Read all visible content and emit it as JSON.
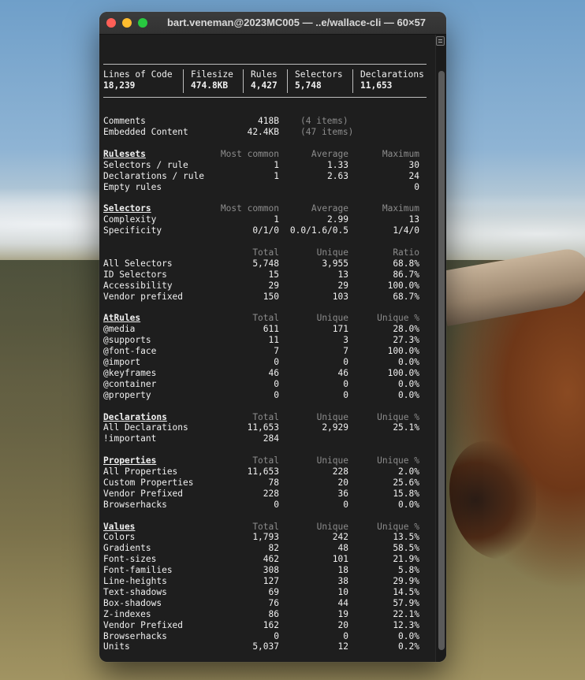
{
  "window": {
    "title": "bart.veneman@2023MC005 — ..e/wallace-cli — 60×57"
  },
  "summary": [
    {
      "label": "Lines of Code",
      "value": "18,239"
    },
    {
      "label": "Filesize",
      "value": "474.8KB"
    },
    {
      "label": "Rules",
      "value": "4,427"
    },
    {
      "label": "Selectors",
      "value": "5,748"
    },
    {
      "label": "Declarations",
      "value": "11,653"
    }
  ],
  "rows": [
    {
      "cells": [
        "Comments",
        "418B",
        "(4 items)",
        ""
      ],
      "dim": [
        false,
        false,
        true,
        false
      ]
    },
    {
      "cells": [
        "Embedded Content",
        "42.4KB",
        "(47 items)",
        ""
      ],
      "dim": [
        false,
        false,
        true,
        false
      ]
    },
    {
      "heading": true,
      "cells": [
        "Rulesets",
        "Most common",
        "Average",
        "Maximum"
      ]
    },
    {
      "cells": [
        "Selectors / rule",
        "1",
        "1.33",
        "30"
      ]
    },
    {
      "cells": [
        "Declarations / rule",
        "1",
        "2.63",
        "24"
      ]
    },
    {
      "cells": [
        "Empty rules",
        "",
        "",
        "0"
      ]
    },
    {
      "heading": true,
      "cells": [
        "Selectors",
        "Most common",
        "Average",
        "Maximum"
      ]
    },
    {
      "cells": [
        "Complexity",
        "1",
        "2.99",
        "13"
      ]
    },
    {
      "cells": [
        "Specificity",
        "0/1/0",
        "0.0/1.6/0.5",
        "1/4/0"
      ]
    },
    {
      "heading": true,
      "noline": true,
      "cells": [
        "",
        "Total",
        "Unique",
        "Ratio"
      ]
    },
    {
      "cells": [
        "All Selectors",
        "5,748",
        "3,955",
        "68.8%"
      ]
    },
    {
      "cells": [
        "ID Selectors",
        "15",
        "13",
        "86.7%"
      ]
    },
    {
      "cells": [
        "Accessibility",
        "29",
        "29",
        "100.0%"
      ]
    },
    {
      "cells": [
        "Vendor prefixed",
        "150",
        "103",
        "68.7%"
      ]
    },
    {
      "heading": true,
      "cells": [
        "AtRules",
        "Total",
        "Unique",
        "Unique %"
      ]
    },
    {
      "cells": [
        "@media",
        "611",
        "171",
        "28.0%"
      ]
    },
    {
      "cells": [
        "@supports",
        "11",
        "3",
        "27.3%"
      ]
    },
    {
      "cells": [
        "@font-face",
        "7",
        "7",
        "100.0%"
      ]
    },
    {
      "cells": [
        "@import",
        "0",
        "0",
        "0.0%"
      ]
    },
    {
      "cells": [
        "@keyframes",
        "46",
        "46",
        "100.0%"
      ]
    },
    {
      "cells": [
        "@container",
        "0",
        "0",
        "0.0%"
      ]
    },
    {
      "cells": [
        "@property",
        "0",
        "0",
        "0.0%"
      ]
    },
    {
      "heading": true,
      "cells": [
        "Declarations",
        "Total",
        "Unique",
        "Unique %"
      ]
    },
    {
      "cells": [
        "All Declarations",
        "11,653",
        "2,929",
        "25.1%"
      ]
    },
    {
      "cells": [
        "!important",
        "284",
        "",
        ""
      ]
    },
    {
      "heading": true,
      "cells": [
        "Properties",
        "Total",
        "Unique",
        "Unique %"
      ]
    },
    {
      "cells": [
        "All Properties",
        "11,653",
        "228",
        "2.0%"
      ]
    },
    {
      "cells": [
        "Custom Properties",
        "78",
        "20",
        "25.6%"
      ]
    },
    {
      "cells": [
        "Vendor Prefixed",
        "228",
        "36",
        "15.8%"
      ]
    },
    {
      "cells": [
        "Browserhacks",
        "0",
        "0",
        "0.0%"
      ]
    },
    {
      "heading": true,
      "cells": [
        "Values",
        "Total",
        "Unique",
        "Unique %"
      ]
    },
    {
      "cells": [
        "Colors",
        "1,793",
        "242",
        "13.5%"
      ]
    },
    {
      "cells": [
        "Gradients",
        "82",
        "48",
        "58.5%"
      ]
    },
    {
      "cells": [
        "Font-sizes",
        "462",
        "101",
        "21.9%"
      ]
    },
    {
      "cells": [
        "Font-families",
        "308",
        "18",
        "5.8%"
      ]
    },
    {
      "cells": [
        "Line-heights",
        "127",
        "38",
        "29.9%"
      ]
    },
    {
      "cells": [
        "Text-shadows",
        "69",
        "10",
        "14.5%"
      ]
    },
    {
      "cells": [
        "Box-shadows",
        "76",
        "44",
        "57.9%"
      ]
    },
    {
      "cells": [
        "Z-indexes",
        "86",
        "19",
        "22.1%"
      ]
    },
    {
      "cells": [
        "Vendor Prefixed",
        "162",
        "20",
        "12.3%"
      ]
    },
    {
      "cells": [
        "Browserhacks",
        "0",
        "0",
        "0.0%"
      ]
    },
    {
      "cells": [
        "Units",
        "5,037",
        "12",
        "0.2%"
      ]
    }
  ]
}
